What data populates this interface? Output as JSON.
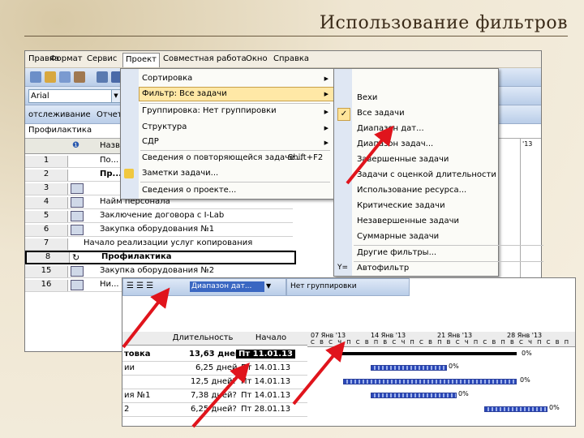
{
  "slide": {
    "title": "Использование фильтров"
  },
  "menubar": {
    "items": [
      "Правка",
      "Формат",
      "Сервис",
      "Проект",
      "Совместная работа",
      "Окно",
      "Справка"
    ],
    "active": "Проект"
  },
  "toolbar": {
    "font": "Arial",
    "tracking": "отслеживание",
    "report": "Отчет",
    "entry_value": "Профилактика"
  },
  "project_menu": [
    {
      "label": "Сортировка",
      "submenu": true
    },
    {
      "label": "Фильтр: Все задачи",
      "submenu": true
    },
    {
      "label": "Группировка: Нет группировки",
      "submenu": true
    },
    {
      "label": "Структура",
      "submenu": true
    },
    {
      "label": "СДР",
      "submenu": true
    },
    {
      "label": "Сведения о повторяющейся задаче...",
      "shortcut": "Shift+F2"
    },
    {
      "label": "Заметки задачи..."
    },
    {
      "label": "Сведения о проекте..."
    }
  ],
  "filter_menu": [
    "Вехи",
    "Все задачи",
    "Диапазон дат...",
    "Диапазон задач...",
    "Завершенные задачи",
    "Задачи с оценкой длительности",
    "Использование ресурса...",
    "Критические задачи",
    "Незавершенные задачи",
    "Суммарные задачи",
    "Другие фильтры...",
    "Автофильтр"
  ],
  "grid": {
    "rows": [
      {
        "id": "1",
        "name": "По..."
      },
      {
        "id": "2",
        "name": "Пр..."
      },
      {
        "id": "3",
        "name": ""
      },
      {
        "id": "4",
        "name": "Найм персонала"
      },
      {
        "id": "5",
        "name": "Заключение договора с I-Lab"
      },
      {
        "id": "6",
        "name": "Закупка оборудования №1"
      },
      {
        "id": "7",
        "name": "Начало реализации услуг копирования"
      },
      {
        "id": "8",
        "name": "Профилактика"
      },
      {
        "id": "15",
        "name": "Закупка оборудования №2"
      },
      {
        "id": "16",
        "name": "Ни..."
      }
    ],
    "header_name": "Назв",
    "gantt_header": "'13",
    "gantt_days": [
      "Ч",
      "П",
      "С",
      "В"
    ],
    "gantt_pct": "0%"
  },
  "bottom": {
    "filter_value": "Диапазон дат...",
    "group_value": "Нет группировки",
    "columns": [
      "Длительность",
      "Начало"
    ],
    "timeline": [
      "07 Янв '13",
      "14 Янв '13",
      "21 Янв '13",
      "28 Янв '13"
    ],
    "days": "С В С Ч П С В П В С Ч П С В П В С Ч П С В П В С Ч П С В П",
    "rows": [
      {
        "name": "товка",
        "dur": "13,63 дней?",
        "start": "Пт 11.01.13"
      },
      {
        "name": "ии",
        "dur": "6,25 дней",
        "start": "Пт 14.01.13"
      },
      {
        "name": "",
        "dur": "12,5 дней?",
        "start": "Пт 14.01.13"
      },
      {
        "name": "ия №1",
        "dur": "7,38 дней?",
        "start": "Пт 14.01.13"
      },
      {
        "name": "2",
        "dur": "6,25 дней?",
        "start": "Пт 28.01.13"
      }
    ],
    "pct": [
      "0%",
      "0%",
      "0%",
      "0%",
      "0%"
    ]
  }
}
